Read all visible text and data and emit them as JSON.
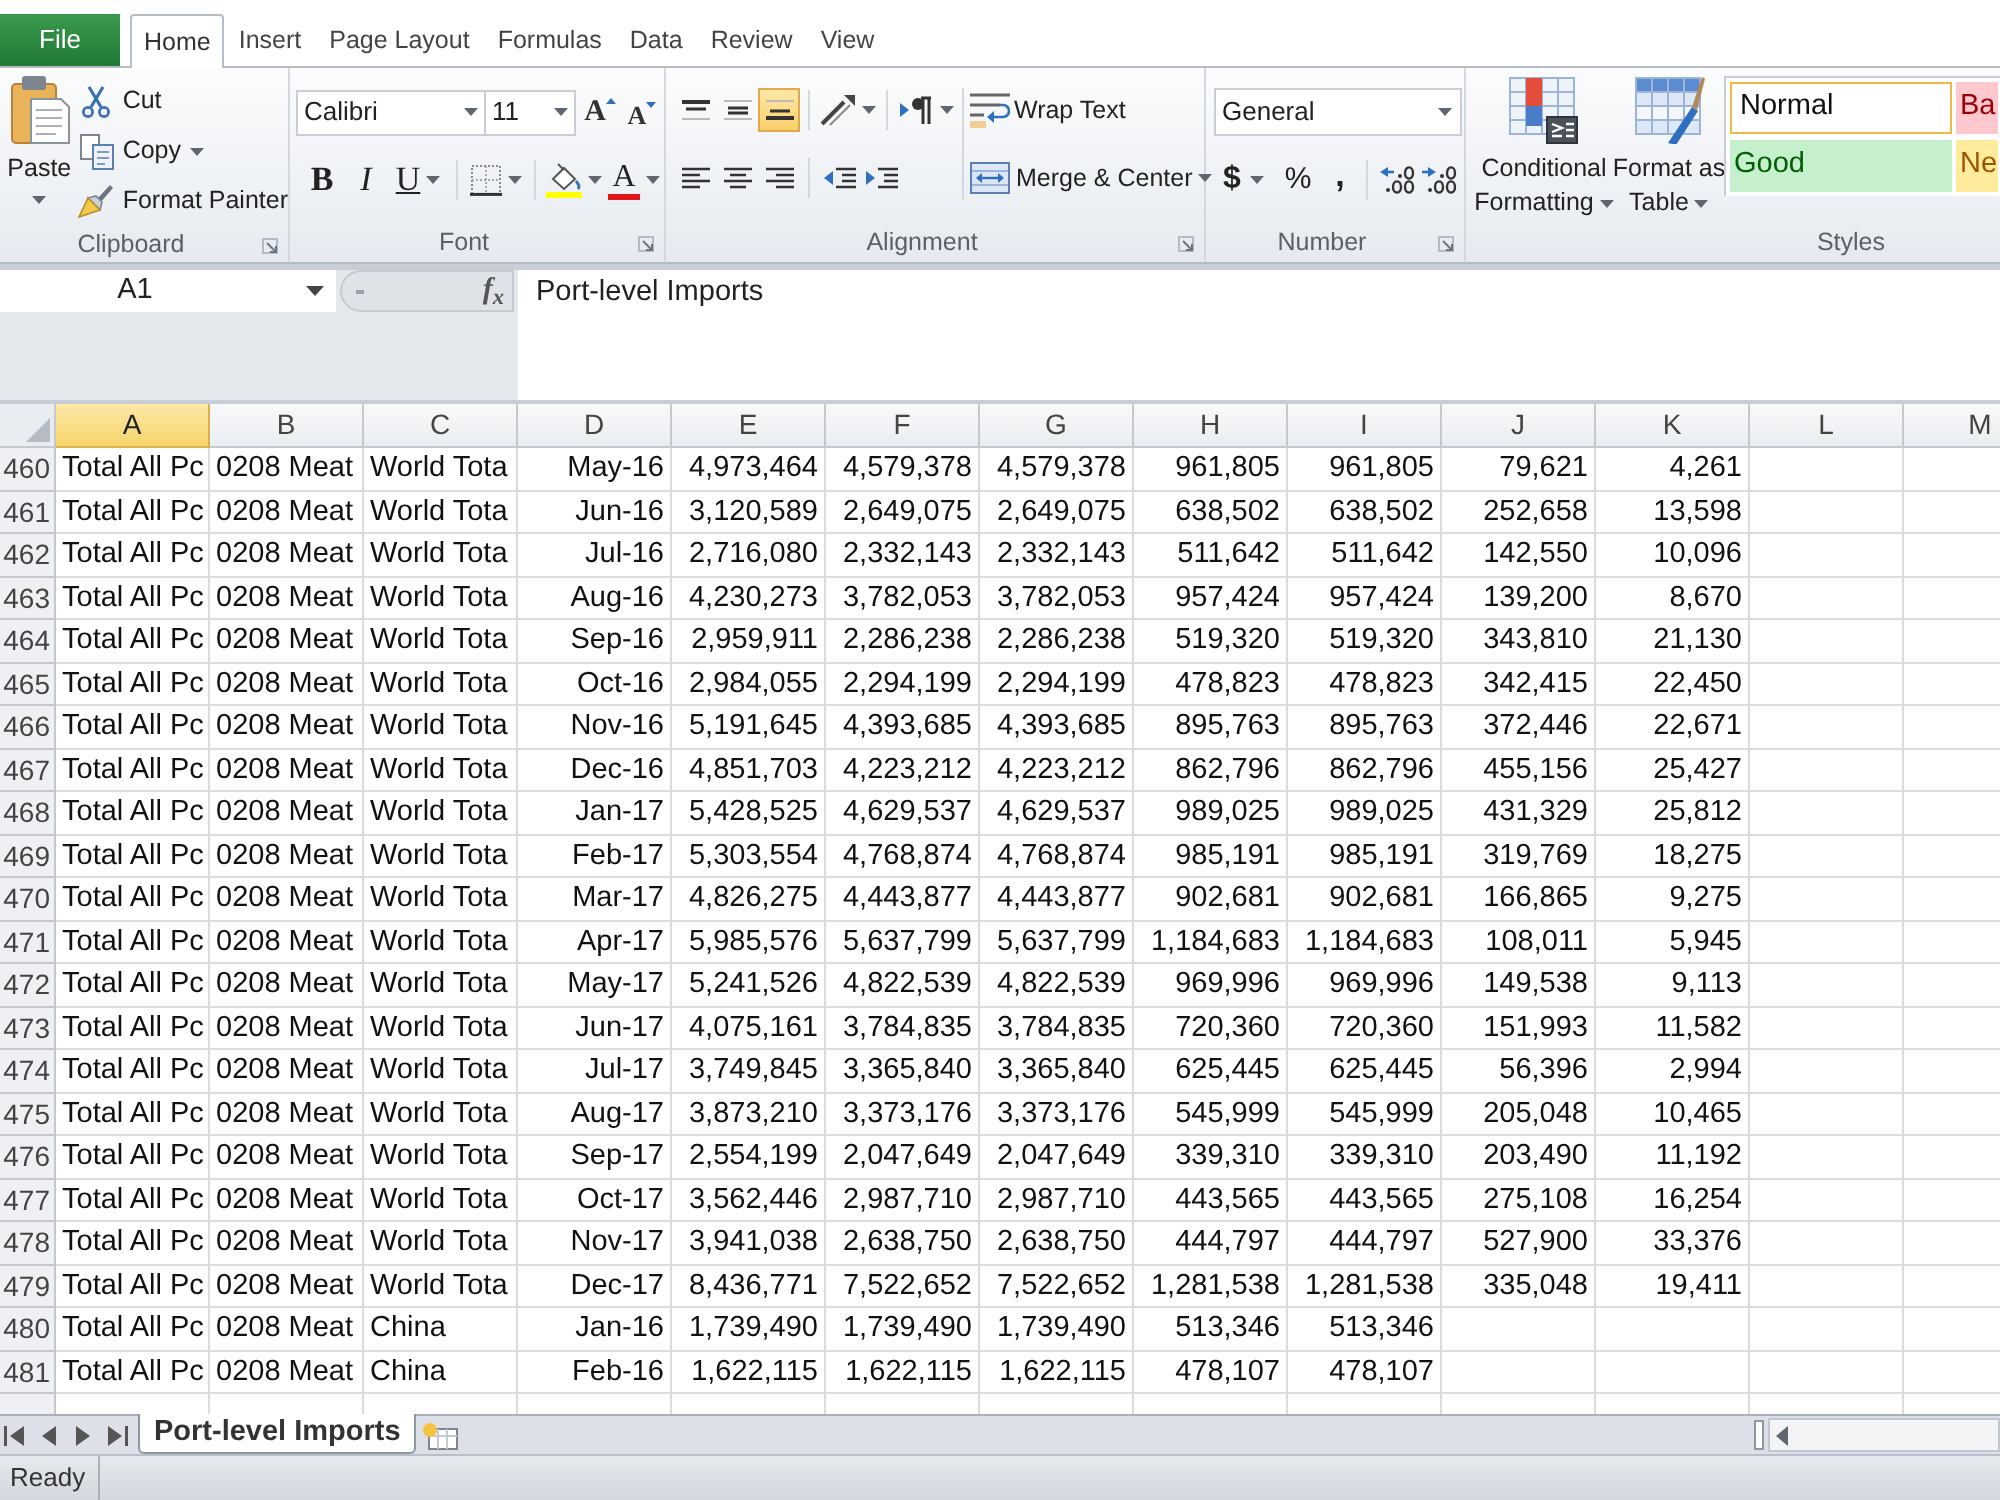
{
  "ribbon_tabs": [
    {
      "label": "File",
      "kind": "file",
      "selected": false
    },
    {
      "label": "Home",
      "kind": "tab",
      "selected": true
    },
    {
      "label": "Insert",
      "kind": "tab",
      "selected": false
    },
    {
      "label": "Page Layout",
      "kind": "tab",
      "selected": false
    },
    {
      "label": "Formulas",
      "kind": "tab",
      "selected": false
    },
    {
      "label": "Data",
      "kind": "tab",
      "selected": false
    },
    {
      "label": "Review",
      "kind": "tab",
      "selected": false
    },
    {
      "label": "View",
      "kind": "tab",
      "selected": false
    }
  ],
  "clipboard": {
    "paste": "Paste",
    "cut": "Cut",
    "copy": "Copy",
    "format_painter": "Format Painter",
    "label": "Clipboard"
  },
  "font": {
    "name": "Calibri",
    "size": "11",
    "grow": "A",
    "shrink": "A",
    "bold": "B",
    "italic": "I",
    "underline": "U",
    "font_color": "A",
    "label": "Font"
  },
  "alignment": {
    "vertical": [
      {
        "kind": "top",
        "selected": false
      },
      {
        "kind": "middle",
        "selected": false
      },
      {
        "kind": "bottom",
        "selected": true
      }
    ],
    "horizontal": [
      {
        "kind": "left",
        "selected": false
      },
      {
        "kind": "center",
        "selected": false
      },
      {
        "kind": "right",
        "selected": false
      }
    ],
    "wrap_text": "Wrap Text",
    "merge": "Merge & Center",
    "label": "Alignment"
  },
  "number": {
    "format": "General",
    "currency": "$",
    "percent": "%",
    "comma": ",",
    "label": "Number"
  },
  "styles": {
    "conditional_formatting": [
      "Conditional",
      "Formatting"
    ],
    "format_as_table": [
      "Format as",
      "Table"
    ],
    "gallery": [
      {
        "label": "Normal",
        "kind": "normal",
        "selected": true
      },
      {
        "label": "Ba",
        "kind": "bad",
        "selected": false
      },
      {
        "label": "Good",
        "kind": "good",
        "selected": false
      },
      {
        "label": "Ne",
        "kind": "neutral",
        "selected": false
      }
    ],
    "label": "Styles"
  },
  "formula_bar": {
    "name_box": "A1",
    "function_button": "f$_{x}$",
    "formula": "Port-level Imports"
  },
  "sheet": {
    "columns": [
      {
        "label": "A",
        "selected": true
      },
      {
        "label": "B",
        "selected": false
      },
      {
        "label": "C",
        "selected": false
      },
      {
        "label": "D",
        "selected": false
      },
      {
        "label": "E",
        "selected": false
      },
      {
        "label": "F",
        "selected": false
      },
      {
        "label": "G",
        "selected": false
      },
      {
        "label": "H",
        "selected": false
      },
      {
        "label": "I",
        "selected": false
      },
      {
        "label": "J",
        "selected": false
      },
      {
        "label": "K",
        "selected": false
      },
      {
        "label": "L",
        "selected": false
      },
      {
        "label": "M",
        "selected": false
      }
    ],
    "rows": [
      {
        "number": "460",
        "cells": [
          "Total All Pc",
          "0208 Meat",
          "World Tota",
          "May-16",
          "4,973,464",
          "4,579,378",
          "4,579,378",
          "961,805",
          "961,805",
          "79,621",
          "4,261"
        ]
      },
      {
        "number": "461",
        "cells": [
          "Total All Pc",
          "0208 Meat",
          "World Tota",
          "Jun-16",
          "3,120,589",
          "2,649,075",
          "2,649,075",
          "638,502",
          "638,502",
          "252,658",
          "13,598"
        ]
      },
      {
        "number": "462",
        "cells": [
          "Total All Pc",
          "0208 Meat",
          "World Tota",
          "Jul-16",
          "2,716,080",
          "2,332,143",
          "2,332,143",
          "511,642",
          "511,642",
          "142,550",
          "10,096"
        ]
      },
      {
        "number": "463",
        "cells": [
          "Total All Pc",
          "0208 Meat",
          "World Tota",
          "Aug-16",
          "4,230,273",
          "3,782,053",
          "3,782,053",
          "957,424",
          "957,424",
          "139,200",
          "8,670"
        ]
      },
      {
        "number": "464",
        "cells": [
          "Total All Pc",
          "0208 Meat",
          "World Tota",
          "Sep-16",
          "2,959,911",
          "2,286,238",
          "2,286,238",
          "519,320",
          "519,320",
          "343,810",
          "21,130"
        ]
      },
      {
        "number": "465",
        "cells": [
          "Total All Pc",
          "0208 Meat",
          "World Tota",
          "Oct-16",
          "2,984,055",
          "2,294,199",
          "2,294,199",
          "478,823",
          "478,823",
          "342,415",
          "22,450"
        ]
      },
      {
        "number": "466",
        "cells": [
          "Total All Pc",
          "0208 Meat",
          "World Tota",
          "Nov-16",
          "5,191,645",
          "4,393,685",
          "4,393,685",
          "895,763",
          "895,763",
          "372,446",
          "22,671"
        ]
      },
      {
        "number": "467",
        "cells": [
          "Total All Pc",
          "0208 Meat",
          "World Tota",
          "Dec-16",
          "4,851,703",
          "4,223,212",
          "4,223,212",
          "862,796",
          "862,796",
          "455,156",
          "25,427"
        ]
      },
      {
        "number": "468",
        "cells": [
          "Total All Pc",
          "0208 Meat",
          "World Tota",
          "Jan-17",
          "5,428,525",
          "4,629,537",
          "4,629,537",
          "989,025",
          "989,025",
          "431,329",
          "25,812"
        ]
      },
      {
        "number": "469",
        "cells": [
          "Total All Pc",
          "0208 Meat",
          "World Tota",
          "Feb-17",
          "5,303,554",
          "4,768,874",
          "4,768,874",
          "985,191",
          "985,191",
          "319,769",
          "18,275"
        ]
      },
      {
        "number": "470",
        "cells": [
          "Total All Pc",
          "0208 Meat",
          "World Tota",
          "Mar-17",
          "4,826,275",
          "4,443,877",
          "4,443,877",
          "902,681",
          "902,681",
          "166,865",
          "9,275"
        ]
      },
      {
        "number": "471",
        "cells": [
          "Total All Pc",
          "0208 Meat",
          "World Tota",
          "Apr-17",
          "5,985,576",
          "5,637,799",
          "5,637,799",
          "1,184,683",
          "1,184,683",
          "108,011",
          "5,945"
        ]
      },
      {
        "number": "472",
        "cells": [
          "Total All Pc",
          "0208 Meat",
          "World Tota",
          "May-17",
          "5,241,526",
          "4,822,539",
          "4,822,539",
          "969,996",
          "969,996",
          "149,538",
          "9,113"
        ]
      },
      {
        "number": "473",
        "cells": [
          "Total All Pc",
          "0208 Meat",
          "World Tota",
          "Jun-17",
          "4,075,161",
          "3,784,835",
          "3,784,835",
          "720,360",
          "720,360",
          "151,993",
          "11,582"
        ]
      },
      {
        "number": "474",
        "cells": [
          "Total All Pc",
          "0208 Meat",
          "World Tota",
          "Jul-17",
          "3,749,845",
          "3,365,840",
          "3,365,840",
          "625,445",
          "625,445",
          "56,396",
          "2,994"
        ]
      },
      {
        "number": "475",
        "cells": [
          "Total All Pc",
          "0208 Meat",
          "World Tota",
          "Aug-17",
          "3,873,210",
          "3,373,176",
          "3,373,176",
          "545,999",
          "545,999",
          "205,048",
          "10,465"
        ]
      },
      {
        "number": "476",
        "cells": [
          "Total All Pc",
          "0208 Meat",
          "World Tota",
          "Sep-17",
          "2,554,199",
          "2,047,649",
          "2,047,649",
          "339,310",
          "339,310",
          "203,490",
          "11,192"
        ]
      },
      {
        "number": "477",
        "cells": [
          "Total All Pc",
          "0208 Meat",
          "World Tota",
          "Oct-17",
          "3,562,446",
          "2,987,710",
          "2,987,710",
          "443,565",
          "443,565",
          "275,108",
          "16,254"
        ]
      },
      {
        "number": "478",
        "cells": [
          "Total All Pc",
          "0208 Meat",
          "World Tota",
          "Nov-17",
          "3,941,038",
          "2,638,750",
          "2,638,750",
          "444,797",
          "444,797",
          "527,900",
          "33,376"
        ]
      },
      {
        "number": "479",
        "cells": [
          "Total All Pc",
          "0208 Meat",
          "World Tota",
          "Dec-17",
          "8,436,771",
          "7,522,652",
          "7,522,652",
          "1,281,538",
          "1,281,538",
          "335,048",
          "19,411"
        ]
      },
      {
        "number": "480",
        "cells": [
          "Total All Pc",
          "0208 Meat",
          "China",
          "Jan-16",
          "1,739,490",
          "1,739,490",
          "1,739,490",
          "513,346",
          "513,346"
        ]
      },
      {
        "number": "481",
        "cells": [
          "Total All Pc",
          "0208 Meat",
          "China",
          "Feb-16",
          "1,622,115",
          "1,622,115",
          "1,622,115",
          "478,107",
          "478,107"
        ]
      }
    ]
  },
  "sheet_tabs": [
    {
      "label": "Port-level Imports",
      "selected": true
    }
  ],
  "status_bar": {
    "text": "Ready"
  }
}
